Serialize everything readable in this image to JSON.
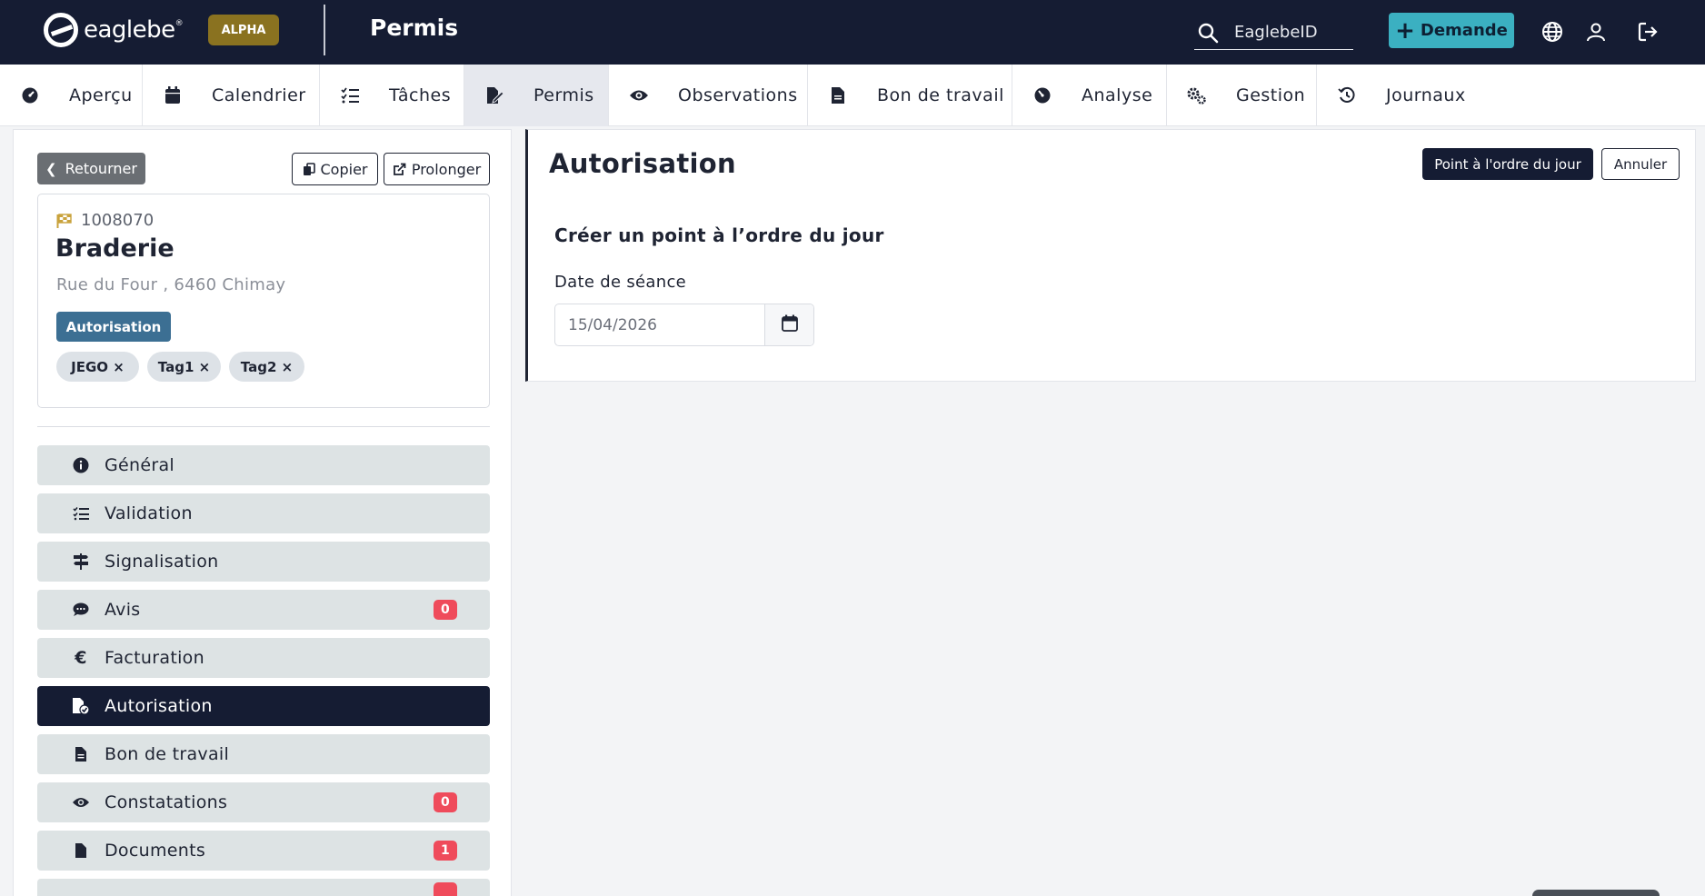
{
  "header": {
    "logo_text": "eaglebe",
    "env_badge": "ALPHA",
    "app_title": "Permis",
    "search_placeholder": "EaglebeID",
    "demande_label": "Demande",
    "icons": [
      "search-icon",
      "globe-icon",
      "user-icon",
      "logout-icon"
    ]
  },
  "nav": {
    "tabs": [
      {
        "label": "Aperçu",
        "icon": "dashboard-icon",
        "active": false
      },
      {
        "label": "Calendrier",
        "icon": "calendar-icon",
        "active": false
      },
      {
        "label": "Tâches",
        "icon": "task-list-icon",
        "active": false
      },
      {
        "label": "Permis",
        "icon": "permit-edit-icon",
        "active": true
      },
      {
        "label": "Observations",
        "icon": "eye-icon",
        "active": false
      },
      {
        "label": "Bon de travail",
        "icon": "document-icon",
        "active": false
      },
      {
        "label": "Analyse",
        "icon": "gauge-icon",
        "active": false
      },
      {
        "label": "Gestion",
        "icon": "gears-icon",
        "active": false
      },
      {
        "label": "Journaux",
        "icon": "history-icon",
        "active": false
      }
    ]
  },
  "left": {
    "back_label": "Retourner",
    "copy_label": "Copier",
    "extend_label": "Prolonger",
    "card": {
      "id": "1008070",
      "title": "Braderie",
      "address": "Rue du Four , 6460 Chimay",
      "status": "Autorisation",
      "tags": [
        "JEGO ×",
        "Tag1 ×",
        "Tag2 ×"
      ]
    },
    "menu": [
      {
        "label": "Général",
        "icon": "info-icon",
        "count": null,
        "active": false
      },
      {
        "label": "Validation",
        "icon": "checklist-icon",
        "count": null,
        "active": false
      },
      {
        "label": "Signalisation",
        "icon": "signpost-icon",
        "count": null,
        "active": false
      },
      {
        "label": "Avis",
        "icon": "comments-icon",
        "count": "0",
        "active": false
      },
      {
        "label": "Facturation",
        "icon": "euro-icon",
        "count": null,
        "active": false
      },
      {
        "label": "Autorisation",
        "icon": "file-check-icon",
        "count": null,
        "active": true
      },
      {
        "label": "Bon de travail",
        "icon": "document-icon",
        "count": null,
        "active": false
      },
      {
        "label": "Constatations",
        "icon": "eye-icon",
        "count": "0",
        "active": false
      },
      {
        "label": "Documents",
        "icon": "file-icon",
        "count": "1",
        "active": false
      }
    ]
  },
  "main": {
    "title": "Autorisation",
    "primary_button": "Point à l'ordre du jour",
    "cancel_button": "Annuler",
    "form_heading": "Créer un point à l’ordre du jour",
    "date_label": "Date de séance",
    "date_value": "15/04/2026"
  },
  "colors": {
    "navy": "#151c33",
    "teal": "#3bb0c1",
    "alpha_gold": "#8a7220",
    "status_blue": "#3c6f93",
    "badge_red": "#ef4b5b"
  }
}
